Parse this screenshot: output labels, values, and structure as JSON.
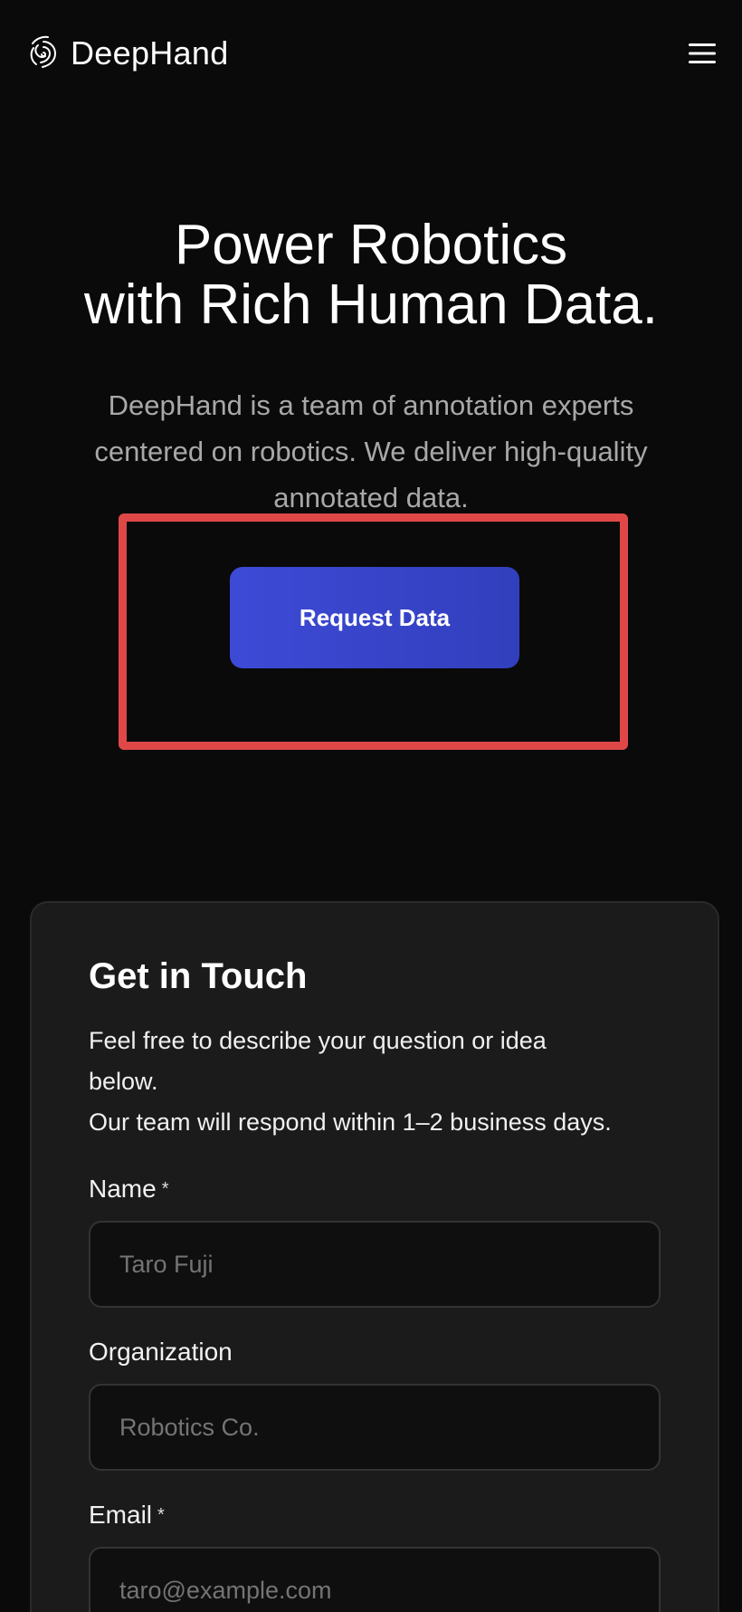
{
  "header": {
    "brand": "DeepHand",
    "logo_icon": "fingerprint-spiral-icon",
    "menu_icon": "hamburger-menu-icon"
  },
  "hero": {
    "title_line1": "Power Robotics",
    "title_line2": "with Rich Human Data.",
    "subtitle_line1": "DeepHand is a team of annotation experts",
    "subtitle_line2": "centered on robotics. We deliver high-quality",
    "subtitle_line3": "annotated data.",
    "cta_label": "Request Data"
  },
  "contact": {
    "title": "Get in Touch",
    "desc_line1": "Feel free to describe your question or idea",
    "desc_line2": "below.",
    "desc_line3": "Our team will respond within 1–2 business days.",
    "fields": [
      {
        "label": "Name",
        "required_mark": "*",
        "placeholder": "Taro Fuji"
      },
      {
        "label": "Organization",
        "placeholder": "Robotics Co."
      },
      {
        "label": "Email",
        "required_mark": "*",
        "placeholder": "taro@example.com"
      }
    ]
  },
  "colors": {
    "background": "#0a0a0a",
    "card_background": "#1b1b1b",
    "accent_button": "#3a46cf",
    "highlight_border": "#e04848",
    "muted_text": "#a8a8a8"
  }
}
